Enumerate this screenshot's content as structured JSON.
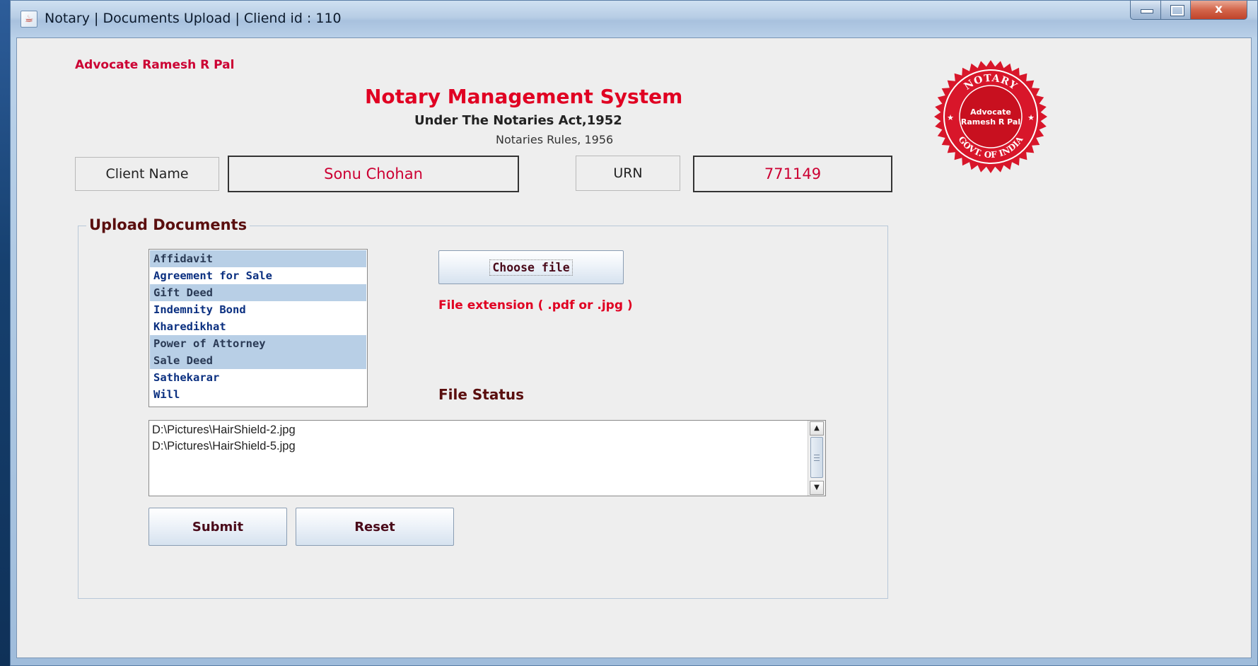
{
  "window": {
    "title": "Notary | Documents Upload | Cliend id : 110",
    "close_glyph": "x"
  },
  "header": {
    "advocate": "Advocate Ramesh R Pal",
    "system_title": "Notary Management System",
    "act": "Under The Notaries Act,1952",
    "rules": "Notaries Rules, 1956"
  },
  "seal": {
    "top_text": "NOTARY",
    "middle_line1": "Advocate",
    "middle_line2": "Ramesh R Pal",
    "bottom_text": "GOVT. OF INDIA",
    "color": "#d8162a"
  },
  "client": {
    "name_label": "Client Name",
    "name_value": "Sonu Chohan",
    "urn_label": "URN",
    "urn_value": "771149"
  },
  "upload": {
    "group_title": "Upload Documents",
    "documents": [
      {
        "label": "Affidavit",
        "selected": true
      },
      {
        "label": "Agreement for Sale",
        "selected": false
      },
      {
        "label": "Gift Deed",
        "selected": true
      },
      {
        "label": "Indemnity Bond",
        "selected": false
      },
      {
        "label": "Kharedikhat",
        "selected": false
      },
      {
        "label": "Power of Attorney",
        "selected": true
      },
      {
        "label": "Sale Deed",
        "selected": true
      },
      {
        "label": "Sathekarar",
        "selected": false
      },
      {
        "label": "Will",
        "selected": false
      }
    ],
    "choose_file_label": "Choose file",
    "extension_note": "File extension ( .pdf or .jpg )",
    "file_status_label": "File Status",
    "files": [
      "D:\\Pictures\\HairShield-2.jpg",
      "D:\\Pictures\\HairShield-5.jpg"
    ],
    "submit_label": "Submit",
    "reset_label": "Reset"
  }
}
